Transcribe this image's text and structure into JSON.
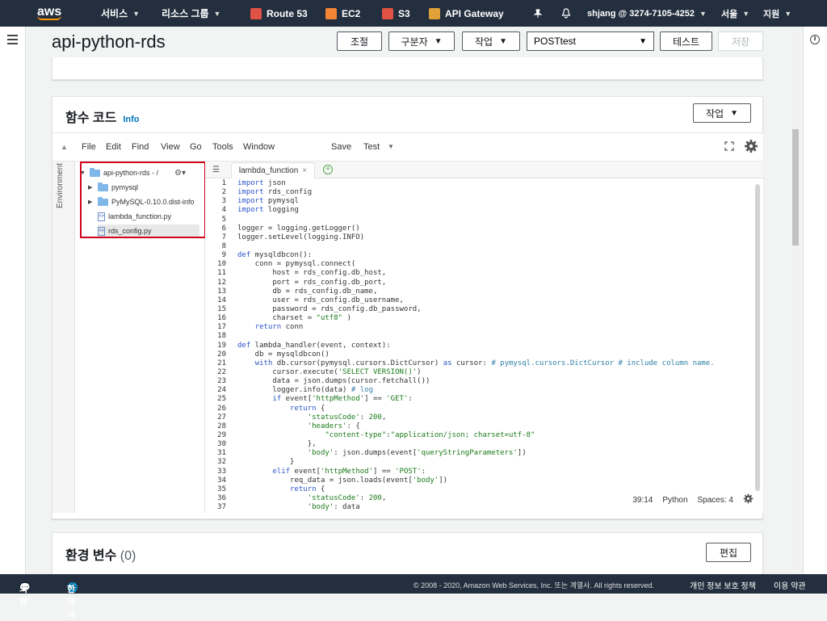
{
  "nav": {
    "logo_text": "aws",
    "services": "서비스",
    "resource_groups": "리소스 그룹",
    "pinned": [
      {
        "label": "Route 53",
        "color": "#e05243",
        "icon": "route53-icon"
      },
      {
        "label": "EC2",
        "color": "#f58536",
        "icon": "ec2-icon"
      },
      {
        "label": "S3",
        "color": "#e05243",
        "icon": "s3-icon"
      },
      {
        "label": "API Gateway",
        "color": "#e0a136",
        "icon": "api-gateway-icon"
      }
    ],
    "account": "shjang @ 3274-7105-4252",
    "region": "서울",
    "support": "지원"
  },
  "header": {
    "title": "api-python-rds",
    "throttle": "조절",
    "qualifiers": "구분자",
    "actions": "작업",
    "test_event": "POSTtest",
    "test": "테스트",
    "save": "저장"
  },
  "function_code": {
    "title": "함수 코드",
    "info": "Info",
    "actions": "작업"
  },
  "ide": {
    "menu": [
      "File",
      "Edit",
      "Find",
      "View",
      "Go",
      "Tools",
      "Window"
    ],
    "save": "Save",
    "test": "Test",
    "env_label": "Environment",
    "tree": {
      "root": "api-python-rds - /",
      "items": [
        {
          "name": "pymysql",
          "type": "folder"
        },
        {
          "name": "PyMySQL-0.10.0.dist-info",
          "type": "folder"
        },
        {
          "name": "lambda_function.py",
          "type": "file"
        },
        {
          "name": "rds_config.py",
          "type": "file"
        }
      ]
    },
    "tab": "lambda_function",
    "status": {
      "pos": "39:14",
      "lang": "Python",
      "spaces": "Spaces: 4"
    }
  },
  "code_lines": [
    "import json",
    "import rds_config",
    "import pymysql",
    "import logging",
    "",
    "logger = logging.getLogger()",
    "logger.setLevel(logging.INFO)",
    "",
    "def mysqldbcon():",
    "    conn = pymysql.connect(",
    "        host = rds_config.db_host,",
    "        port = rds_config.db_port,",
    "        db = rds_config.db_name,",
    "        user = rds_config.db_username,",
    "        password = rds_config.db_password,",
    "        charset = \"utf8\" )",
    "    return conn",
    "",
    "def lambda_handler(event, context):",
    "    db = mysqldbcon()",
    "    with db.cursor(pymysql.cursors.DictCursor) as cursor: # pymysql.cursors.DictCursor # include column name.",
    "        cursor.execute('SELECT VERSION()')",
    "        data = json.dumps(cursor.fetchall())",
    "        logger.info(data) # log",
    "        if event['httpMethod'] == 'GET':",
    "            return {",
    "                'statusCode': 200,",
    "                'headers': {",
    "                    \"content-type\":\"application/json; charset=utf-8\"",
    "                },",
    "                'body': json.dumps(event['queryStringParameters'])",
    "            }",
    "        elif event['httpMethod'] == 'POST':",
    "            req_data = json.loads(event['body'])",
    "            return {",
    "                'statusCode': 200,",
    "                'body': data"
  ],
  "env_vars": {
    "title": "환경 변수",
    "count": "(0)",
    "edit": "편집"
  },
  "footer": {
    "feedback": "의견",
    "language": "한국어",
    "copyright": "© 2008 - 2020, Amazon Web Services, Inc. 또는 계열사. All rights reserved.",
    "privacy": "개인 정보 보호 정책",
    "terms": "이용 약관"
  }
}
